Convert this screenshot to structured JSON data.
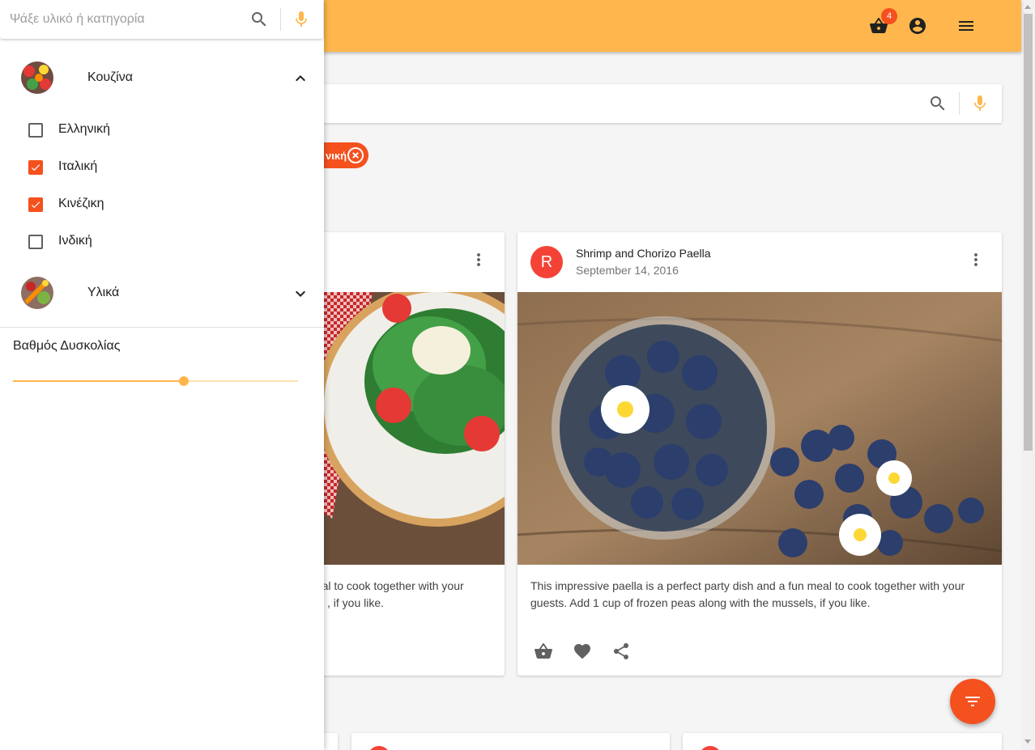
{
  "appbar": {
    "cart_badge": "4",
    "accent_color": "#ffb74d"
  },
  "drawer": {
    "search": {
      "placeholder": "Ψάξε υλικό ή κατηγορία",
      "value": ""
    },
    "categories": [
      {
        "label": "Κουζίνα",
        "expanded": true,
        "icon": "vegetables-photo"
      },
      {
        "label": "Υλικά",
        "expanded": false,
        "icon": "vegetables-photo"
      }
    ],
    "cuisine_options": [
      {
        "label": "Ελληνική",
        "checked": false
      },
      {
        "label": "Ιταλική",
        "checked": true
      },
      {
        "label": "Κινέζικη",
        "checked": true
      },
      {
        "label": "Ινδική",
        "checked": false
      }
    ],
    "difficulty": {
      "label": "Βαθμός Δυσκολίας",
      "value": 0.6
    }
  },
  "main": {
    "search": {
      "placeholder": "",
      "value": ""
    },
    "chip": {
      "label": "νική"
    },
    "cards": [
      {
        "title": "",
        "date": "",
        "text_line1": "neal to cook together with your",
        "text_line2": ", if you like.",
        "image": "salad-photo"
      },
      {
        "avatar": "R",
        "title": "Shrimp and Chorizo Paella",
        "date": "September 14, 2016",
        "text_line1": "This impressive paella is a perfect party dish and a fun meal to cook together with your",
        "text_line2": "guests. Add 1 cup of frozen peas along with the mussels, if you like.",
        "image": "blueberries-photo"
      }
    ]
  },
  "colors": {
    "primary": "#ffb74d",
    "accent": "#f4511e",
    "avatar": "#f44336"
  }
}
